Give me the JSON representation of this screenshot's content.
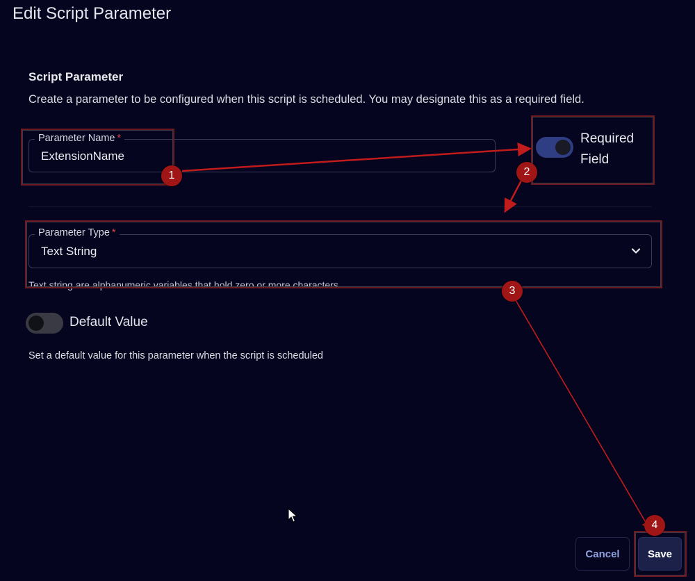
{
  "dialog": {
    "title": "Edit Script Parameter"
  },
  "section": {
    "title": "Script Parameter",
    "description": "Create a parameter to be configured when this script is scheduled. You may designate this as a required field."
  },
  "parameter_name": {
    "label": "Parameter Name",
    "required_marker": "*",
    "value": "ExtensionName"
  },
  "required_field": {
    "label_line1": "Required",
    "label_line2": "Field",
    "checked": true
  },
  "parameter_type": {
    "label": "Parameter Type",
    "required_marker": "*",
    "selected": "Text String",
    "helper": "Text string are alphanumeric variables that hold zero or more characters."
  },
  "default_value": {
    "label": "Default Value",
    "checked": false,
    "description": "Set a default value for this parameter when the script is scheduled"
  },
  "buttons": {
    "cancel": "Cancel",
    "save": "Save"
  },
  "annotations": {
    "badges": [
      "1",
      "2",
      "3",
      "4"
    ]
  },
  "colors": {
    "background": "#050520",
    "toggle_on": "#2f3d82",
    "annotation_red": "#a01616",
    "cancel_text": "#8fa0dc",
    "save_bg": "#1b2148"
  }
}
